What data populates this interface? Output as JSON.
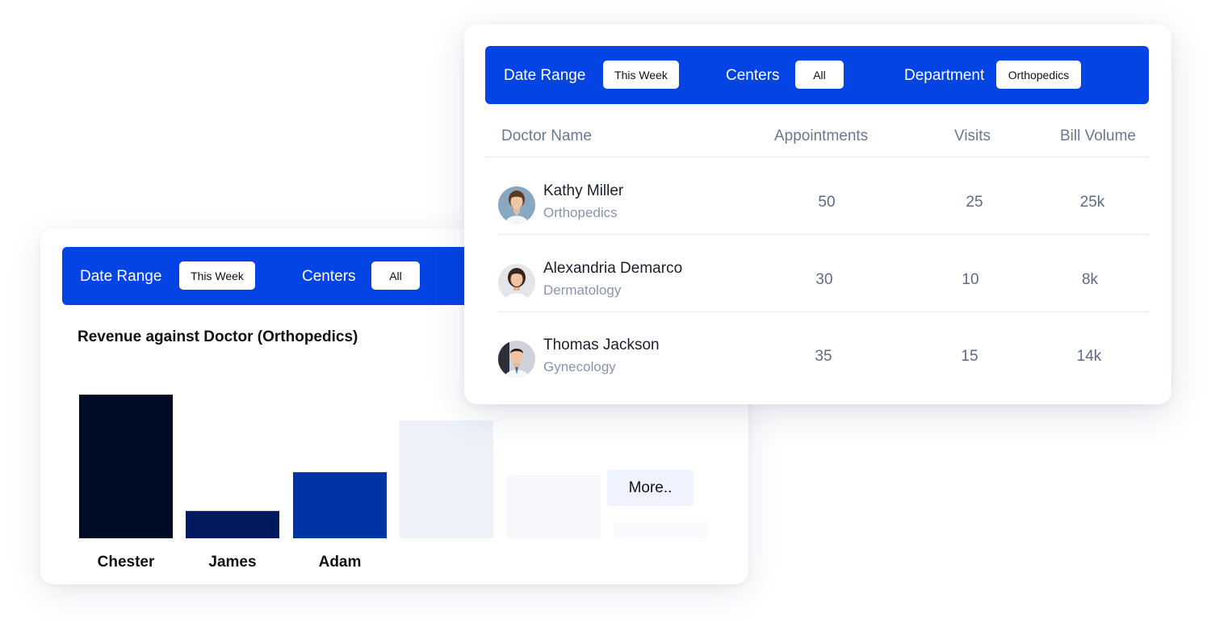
{
  "chart_panel": {
    "filters": {
      "date_range_label": "Date Range",
      "date_range_value": "This Week",
      "centers_label": "Centers",
      "centers_value": "All"
    },
    "more_label": "More..",
    "colors": {
      "bar_dark": "#000b24",
      "bar_navy": "#001a5e",
      "bar_blue": "#0033a3",
      "bar_ghost": "#eef2f8"
    }
  },
  "chart_data": {
    "type": "bar",
    "title": "Revenue against Doctor (Orthopedics)",
    "categories": [
      "Chester",
      "James",
      "Adam",
      "",
      "",
      ""
    ],
    "values": [
      100,
      19,
      46,
      82,
      44,
      11
    ],
    "xlabel": "",
    "ylabel": "",
    "grid": false
  },
  "table_panel": {
    "filters": {
      "date_range_label": "Date Range",
      "date_range_value": "This Week",
      "centers_label": "Centers",
      "centers_value": "All",
      "department_label": "Department",
      "department_value": "Orthopedics"
    },
    "headers": {
      "doctor": "Doctor Name",
      "appointments": "Appointments",
      "visits": "Visits",
      "bill": "Bill Volume"
    },
    "rows": [
      {
        "name": "Kathy Miller",
        "dept": "Orthopedics",
        "appointments": "50",
        "visits": "25",
        "bill": "25k",
        "avatar": "doctor-female-avatar"
      },
      {
        "name": "Alexandria Demarco",
        "dept": "Dermatology",
        "appointments": "30",
        "visits": "10",
        "bill": "8k",
        "avatar": "doctor-female-avatar"
      },
      {
        "name": "Thomas Jackson",
        "dept": "Gynecology",
        "appointments": "35",
        "visits": "15",
        "bill": "14k",
        "avatar": "doctor-male-avatar"
      }
    ]
  },
  "colors": {
    "accent": "#0443e4",
    "header_text": "#6b7891",
    "muted_text": "#8a94a8"
  }
}
